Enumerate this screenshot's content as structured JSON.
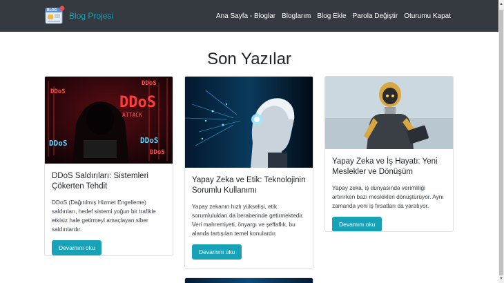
{
  "brand": {
    "name": "Blog Projesi",
    "logo_text": "BLOG",
    "accent": "#17a2b8"
  },
  "nav": {
    "items": [
      {
        "label": "Ana Sayfa - Bloglar"
      },
      {
        "label": "Bloglarım"
      },
      {
        "label": "Blog Ekle"
      },
      {
        "label": "Parola Değiştir"
      },
      {
        "label": "Oturumu Kapat"
      }
    ]
  },
  "page": {
    "title": "Son Yazılar"
  },
  "posts": [
    {
      "title": "DDoS Saldırıları: Sistemleri Çökerten Tehdit",
      "summary": "DDoS (Dağıtılmış Hizmet Engelleme) saldırıları, hedef sistemi yoğun bir trafikle etkisiz hale getirmeyi amaçlayan siber saldırılardır.",
      "button": "Devamını oku",
      "image_icon": "ddos-attack-image",
      "image_text": {
        "big": "DDoS",
        "small": "ATTACK"
      }
    },
    {
      "title": "Yapay Zeka ve Etik: Teknolojinin Sorumlu Kullanımı",
      "summary": "Yapay zekanın hızlı yükselişi, etik sorumlulukları da beraberinde getirmektedir. Veri mahremiyeti, önyargı ve şeffaflık, bu alanda tartışılan temel konulardır.",
      "button": "Devamını oku",
      "image_icon": "ai-robot-head-image"
    },
    {
      "title": "Yapay Zeka ve İş Hayatı: Yeni Meslekler ve Dönüşüm",
      "summary": "Yapay zeka, iş dünyasında verimliliği artırırken bazı meslekleri dönüştürüyor. Aynı zamanda yeni iş fırsatları da yaratıyor.",
      "button": "Devamını oku",
      "image_icon": "robot-with-tablet-image"
    }
  ],
  "colors": {
    "navbar": "#343a40",
    "button": "#17a2b8"
  }
}
